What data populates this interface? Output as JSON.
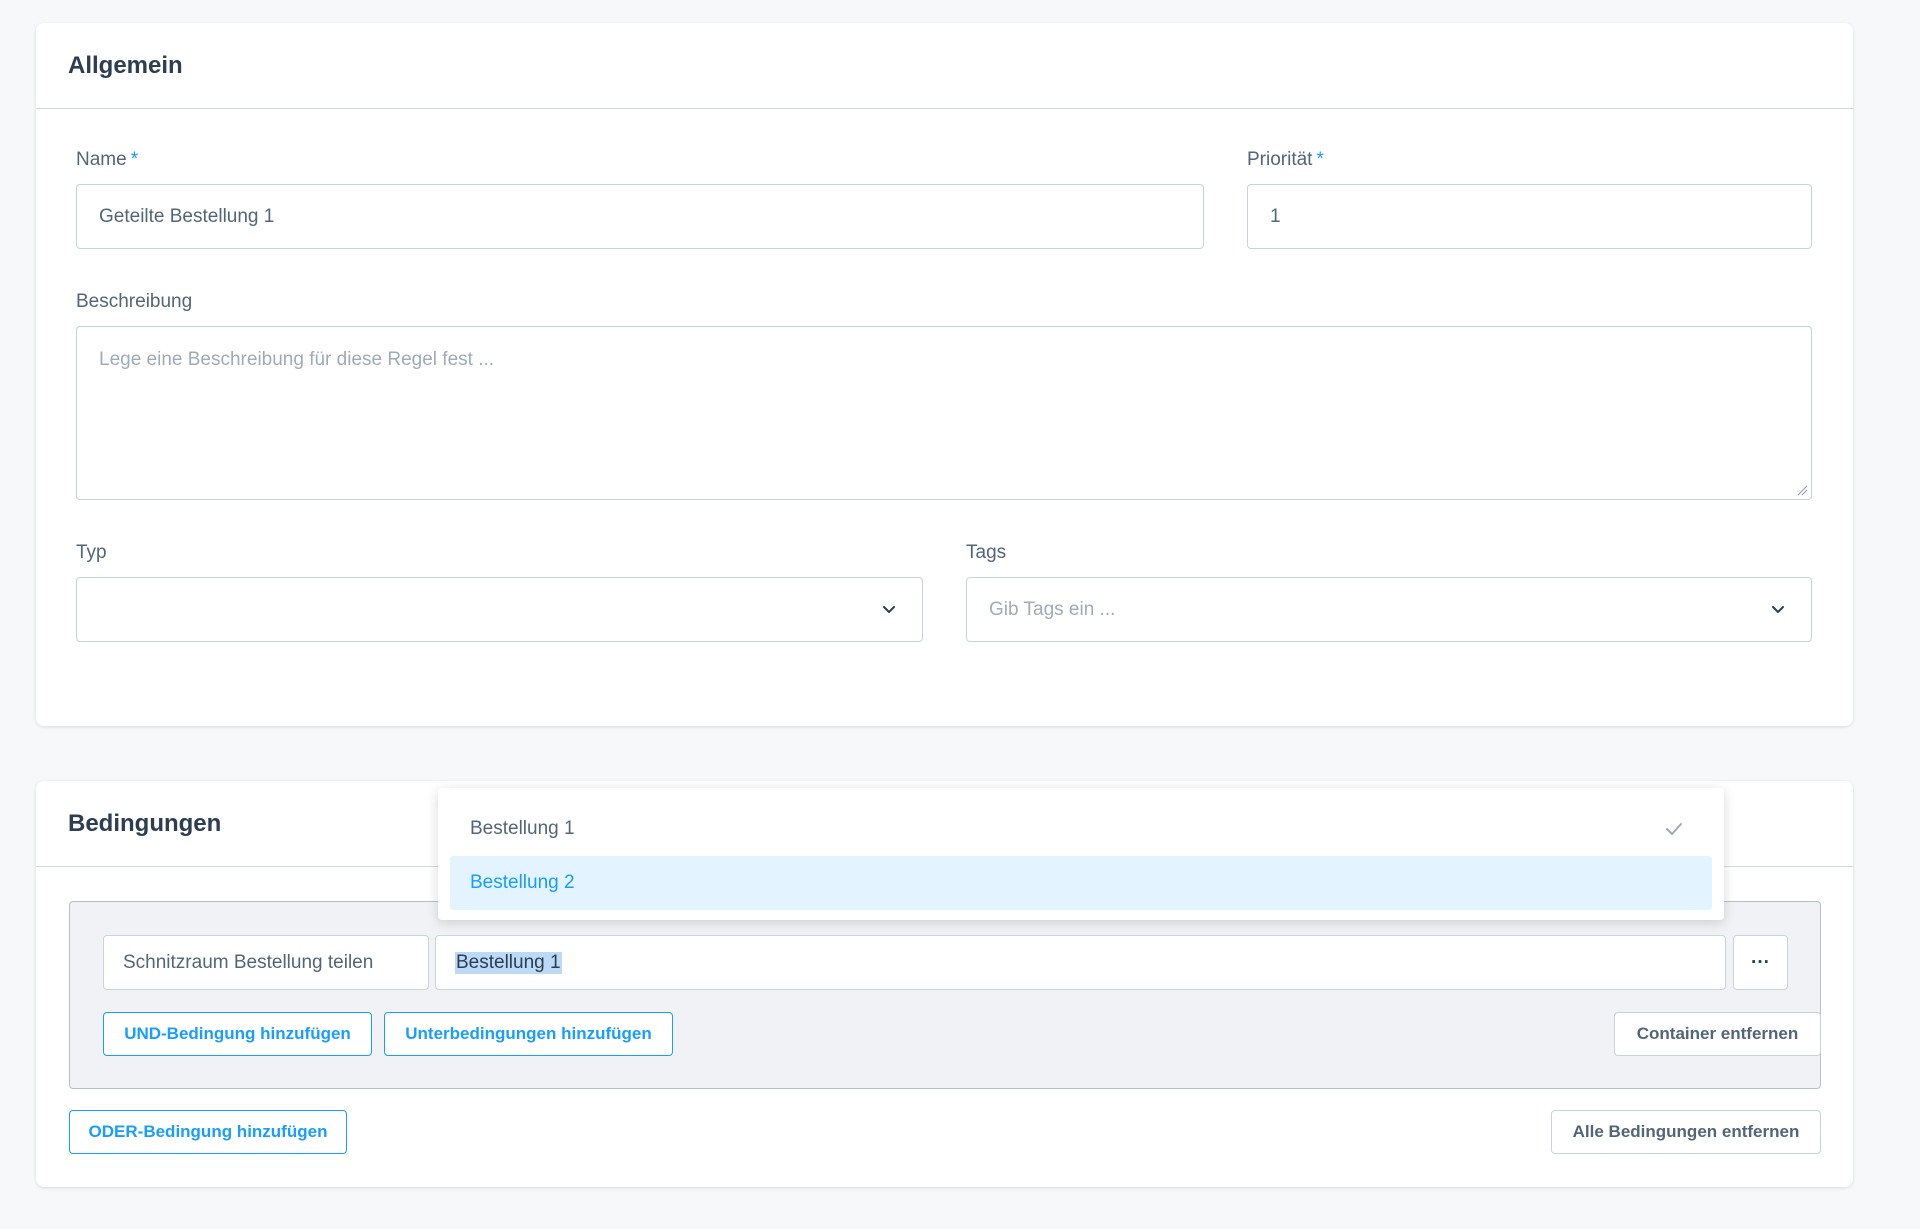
{
  "general": {
    "title": "Allgemein",
    "name_label": "Name",
    "name_value": "Geteilte Bestellung 1",
    "priority_label": "Priorität",
    "priority_value": "1",
    "required_marker": "*",
    "description_label": "Beschreibung",
    "description_placeholder": "Lege eine Beschreibung für diese Regel fest ...",
    "type_label": "Typ",
    "type_value": "",
    "tags_label": "Tags",
    "tags_placeholder": "Gib Tags ein ..."
  },
  "conditions": {
    "title": "Bedingungen",
    "condition_field": "Schnitzraum Bestellung teilen",
    "condition_value": "Bestellung 1",
    "more_label": "···",
    "add_and_label": "UND-Bedingung hinzufügen",
    "add_sub_label": "Unterbedingungen hinzufügen",
    "remove_container_label": "Container entfernen",
    "add_or_label": "ODER-Bedingung hinzufügen",
    "remove_all_label": "Alle Bedingungen entfernen"
  },
  "dropdown": {
    "options": [
      {
        "label": "Bestellung 1",
        "selected": true,
        "highlighted": false
      },
      {
        "label": "Bestellung 2",
        "selected": false,
        "highlighted": true
      }
    ]
  },
  "colors": {
    "accent": "#189eff",
    "highlight_bg": "#e3f3ff",
    "text": "#2c3e50",
    "muted": "#52667a"
  },
  "icons": [
    "chevron-down-icon",
    "checkmark-icon",
    "resize-grip-icon"
  ]
}
